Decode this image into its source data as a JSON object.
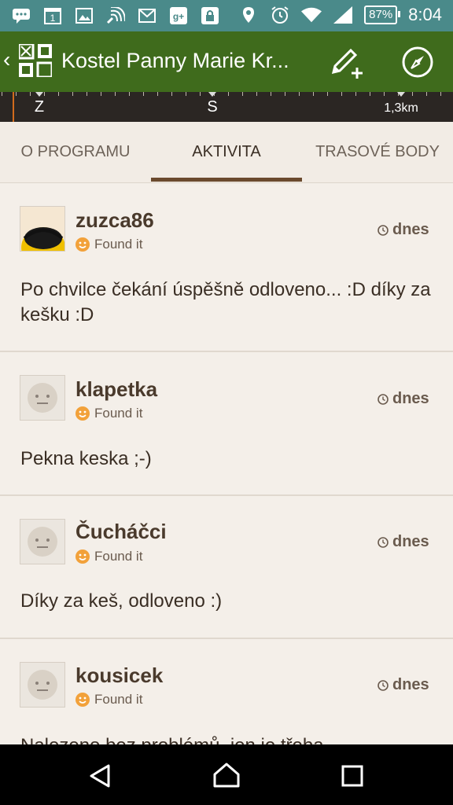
{
  "status_bar": {
    "icons": [
      "chat-icon",
      "calendar-icon",
      "gallery-icon",
      "wifi-calling-icon",
      "mail-icon",
      "google-plus-icon",
      "lock-icon"
    ],
    "calendar_day": "1",
    "battery": "87%",
    "time": "8:04"
  },
  "app_bar": {
    "title": "Kostel Panny Marie Kr...",
    "back_glyph": "‹"
  },
  "ruler": {
    "labels": [
      "Z",
      "S",
      "1,3km"
    ]
  },
  "tabs": [
    {
      "label": "O PROGRAMU",
      "active": false
    },
    {
      "label": "AKTIVITA",
      "active": true
    },
    {
      "label": "TRASOVÉ BODY",
      "active": false
    }
  ],
  "logs": [
    {
      "user": "zuzca86",
      "type": "Found it",
      "date": "dnes",
      "text": "Po chvilce čekání úspěšně odloveno... :D díky za kešku :D",
      "avatar": "photo"
    },
    {
      "user": "klapetka",
      "type": "Found it",
      "date": "dnes",
      "text": "Pekna keska ;-)",
      "avatar": "default"
    },
    {
      "user": "Čucháčci",
      "type": "Found it",
      "date": "dnes",
      "text": "Díky za keš, odloveno :)",
      "avatar": "default"
    },
    {
      "user": "kousicek",
      "type": "Found it",
      "date": "dnes",
      "text": "Nalezeno bez problémů, jen je třeba",
      "avatar": "default"
    }
  ],
  "colors": {
    "status_bar": "#4a8a8a",
    "app_bar": "#3f6b1c",
    "accent": "#6b4a2e",
    "found_it": "#f2a13a"
  }
}
